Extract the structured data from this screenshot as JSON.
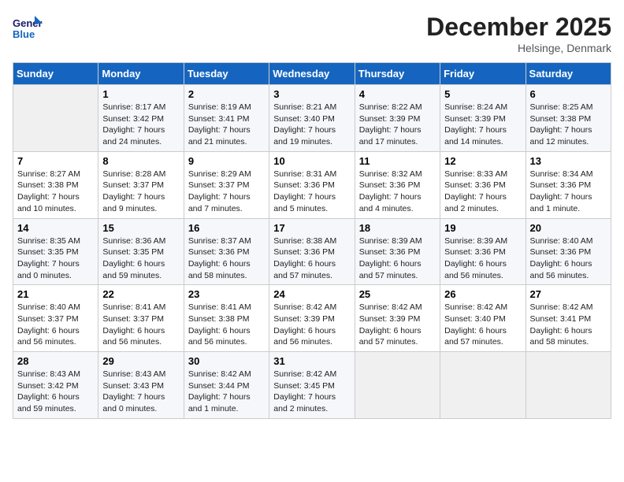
{
  "header": {
    "logo_general": "General",
    "logo_blue": "Blue",
    "month": "December 2025",
    "location": "Helsinge, Denmark"
  },
  "days_of_week": [
    "Sunday",
    "Monday",
    "Tuesday",
    "Wednesday",
    "Thursday",
    "Friday",
    "Saturday"
  ],
  "weeks": [
    [
      {
        "day": "",
        "sunrise": "",
        "sunset": "",
        "daylight": "",
        "empty": true
      },
      {
        "day": "1",
        "sunrise": "Sunrise: 8:17 AM",
        "sunset": "Sunset: 3:42 PM",
        "daylight": "Daylight: 7 hours and 24 minutes."
      },
      {
        "day": "2",
        "sunrise": "Sunrise: 8:19 AM",
        "sunset": "Sunset: 3:41 PM",
        "daylight": "Daylight: 7 hours and 21 minutes."
      },
      {
        "day": "3",
        "sunrise": "Sunrise: 8:21 AM",
        "sunset": "Sunset: 3:40 PM",
        "daylight": "Daylight: 7 hours and 19 minutes."
      },
      {
        "day": "4",
        "sunrise": "Sunrise: 8:22 AM",
        "sunset": "Sunset: 3:39 PM",
        "daylight": "Daylight: 7 hours and 17 minutes."
      },
      {
        "day": "5",
        "sunrise": "Sunrise: 8:24 AM",
        "sunset": "Sunset: 3:39 PM",
        "daylight": "Daylight: 7 hours and 14 minutes."
      },
      {
        "day": "6",
        "sunrise": "Sunrise: 8:25 AM",
        "sunset": "Sunset: 3:38 PM",
        "daylight": "Daylight: 7 hours and 12 minutes."
      }
    ],
    [
      {
        "day": "7",
        "sunrise": "Sunrise: 8:27 AM",
        "sunset": "Sunset: 3:38 PM",
        "daylight": "Daylight: 7 hours and 10 minutes."
      },
      {
        "day": "8",
        "sunrise": "Sunrise: 8:28 AM",
        "sunset": "Sunset: 3:37 PM",
        "daylight": "Daylight: 7 hours and 9 minutes."
      },
      {
        "day": "9",
        "sunrise": "Sunrise: 8:29 AM",
        "sunset": "Sunset: 3:37 PM",
        "daylight": "Daylight: 7 hours and 7 minutes."
      },
      {
        "day": "10",
        "sunrise": "Sunrise: 8:31 AM",
        "sunset": "Sunset: 3:36 PM",
        "daylight": "Daylight: 7 hours and 5 minutes."
      },
      {
        "day": "11",
        "sunrise": "Sunrise: 8:32 AM",
        "sunset": "Sunset: 3:36 PM",
        "daylight": "Daylight: 7 hours and 4 minutes."
      },
      {
        "day": "12",
        "sunrise": "Sunrise: 8:33 AM",
        "sunset": "Sunset: 3:36 PM",
        "daylight": "Daylight: 7 hours and 2 minutes."
      },
      {
        "day": "13",
        "sunrise": "Sunrise: 8:34 AM",
        "sunset": "Sunset: 3:36 PM",
        "daylight": "Daylight: 7 hours and 1 minute."
      }
    ],
    [
      {
        "day": "14",
        "sunrise": "Sunrise: 8:35 AM",
        "sunset": "Sunset: 3:35 PM",
        "daylight": "Daylight: 7 hours and 0 minutes."
      },
      {
        "day": "15",
        "sunrise": "Sunrise: 8:36 AM",
        "sunset": "Sunset: 3:35 PM",
        "daylight": "Daylight: 6 hours and 59 minutes."
      },
      {
        "day": "16",
        "sunrise": "Sunrise: 8:37 AM",
        "sunset": "Sunset: 3:36 PM",
        "daylight": "Daylight: 6 hours and 58 minutes."
      },
      {
        "day": "17",
        "sunrise": "Sunrise: 8:38 AM",
        "sunset": "Sunset: 3:36 PM",
        "daylight": "Daylight: 6 hours and 57 minutes."
      },
      {
        "day": "18",
        "sunrise": "Sunrise: 8:39 AM",
        "sunset": "Sunset: 3:36 PM",
        "daylight": "Daylight: 6 hours and 57 minutes."
      },
      {
        "day": "19",
        "sunrise": "Sunrise: 8:39 AM",
        "sunset": "Sunset: 3:36 PM",
        "daylight": "Daylight: 6 hours and 56 minutes."
      },
      {
        "day": "20",
        "sunrise": "Sunrise: 8:40 AM",
        "sunset": "Sunset: 3:36 PM",
        "daylight": "Daylight: 6 hours and 56 minutes."
      }
    ],
    [
      {
        "day": "21",
        "sunrise": "Sunrise: 8:40 AM",
        "sunset": "Sunset: 3:37 PM",
        "daylight": "Daylight: 6 hours and 56 minutes."
      },
      {
        "day": "22",
        "sunrise": "Sunrise: 8:41 AM",
        "sunset": "Sunset: 3:37 PM",
        "daylight": "Daylight: 6 hours and 56 minutes."
      },
      {
        "day": "23",
        "sunrise": "Sunrise: 8:41 AM",
        "sunset": "Sunset: 3:38 PM",
        "daylight": "Daylight: 6 hours and 56 minutes."
      },
      {
        "day": "24",
        "sunrise": "Sunrise: 8:42 AM",
        "sunset": "Sunset: 3:39 PM",
        "daylight": "Daylight: 6 hours and 56 minutes."
      },
      {
        "day": "25",
        "sunrise": "Sunrise: 8:42 AM",
        "sunset": "Sunset: 3:39 PM",
        "daylight": "Daylight: 6 hours and 57 minutes."
      },
      {
        "day": "26",
        "sunrise": "Sunrise: 8:42 AM",
        "sunset": "Sunset: 3:40 PM",
        "daylight": "Daylight: 6 hours and 57 minutes."
      },
      {
        "day": "27",
        "sunrise": "Sunrise: 8:42 AM",
        "sunset": "Sunset: 3:41 PM",
        "daylight": "Daylight: 6 hours and 58 minutes."
      }
    ],
    [
      {
        "day": "28",
        "sunrise": "Sunrise: 8:43 AM",
        "sunset": "Sunset: 3:42 PM",
        "daylight": "Daylight: 6 hours and 59 minutes."
      },
      {
        "day": "29",
        "sunrise": "Sunrise: 8:43 AM",
        "sunset": "Sunset: 3:43 PM",
        "daylight": "Daylight: 7 hours and 0 minutes."
      },
      {
        "day": "30",
        "sunrise": "Sunrise: 8:42 AM",
        "sunset": "Sunset: 3:44 PM",
        "daylight": "Daylight: 7 hours and 1 minute."
      },
      {
        "day": "31",
        "sunrise": "Sunrise: 8:42 AM",
        "sunset": "Sunset: 3:45 PM",
        "daylight": "Daylight: 7 hours and 2 minutes."
      },
      {
        "day": "",
        "sunrise": "",
        "sunset": "",
        "daylight": "",
        "empty": true
      },
      {
        "day": "",
        "sunrise": "",
        "sunset": "",
        "daylight": "",
        "empty": true
      },
      {
        "day": "",
        "sunrise": "",
        "sunset": "",
        "daylight": "",
        "empty": true
      }
    ]
  ]
}
